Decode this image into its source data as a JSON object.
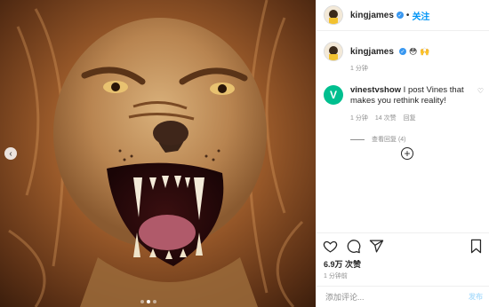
{
  "header": {
    "username": "kingjames",
    "separator": "•",
    "follow_label": "关注"
  },
  "caption": {
    "username": "kingjames",
    "emoji_1": "😳",
    "emoji_2": "🙌",
    "time": "1 分钟"
  },
  "comment": {
    "username": "vinestvshow",
    "text": "I post Vines that makes you rethink reality!",
    "avatar_letter": "V",
    "time": "1 分钟",
    "likes": "14 次赞",
    "reply_label": "回复",
    "view_replies": "查看回复 (4)"
  },
  "post": {
    "likes": "6.9万 次赞",
    "time_ago": "1 分钟前"
  },
  "add_comment": {
    "placeholder": "添加评论...",
    "post_label": "发布"
  },
  "carousel": {
    "prev_icon": "‹",
    "current_slide": 2,
    "total_slides": 3
  },
  "colors": {
    "accent": "#0095f6",
    "verified": "#3897f0",
    "vine": "#00bf8f",
    "muted": "#8e8e8e"
  }
}
